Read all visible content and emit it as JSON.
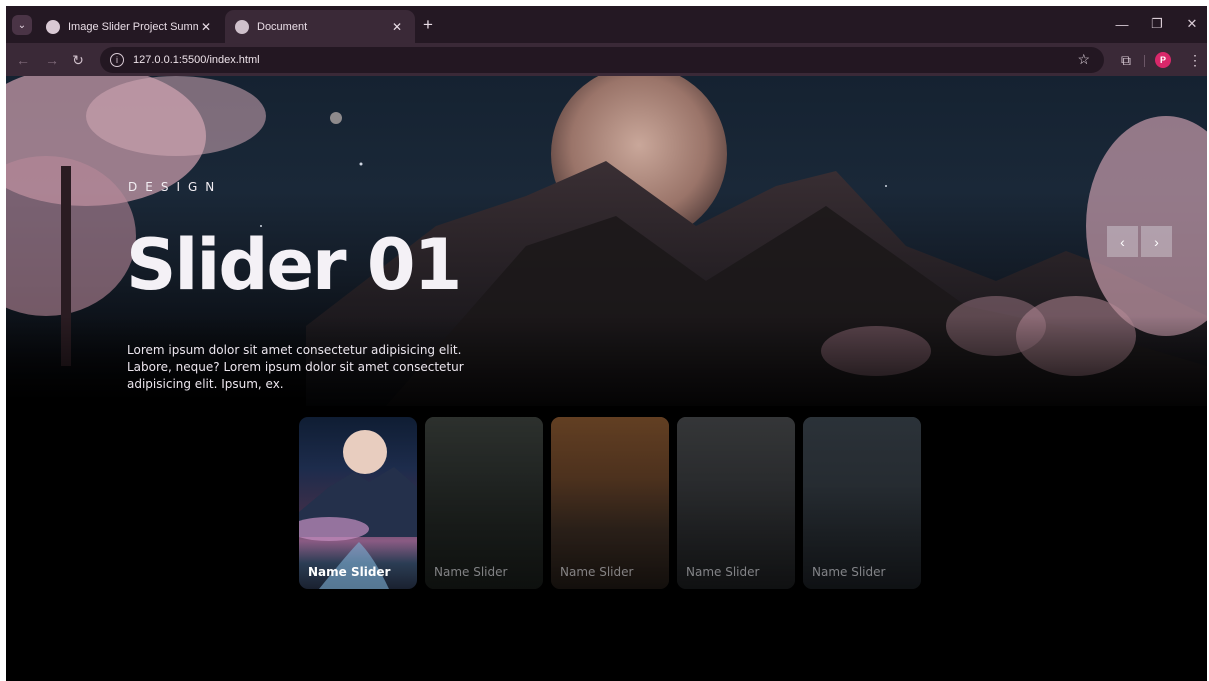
{
  "browser": {
    "tabs": [
      {
        "title": "Image Slider Project Summary",
        "active": false
      },
      {
        "title": "Document",
        "active": true
      }
    ],
    "new_tab_label": "+",
    "url": "127.0.0.1:5500/index.html",
    "profile_initial": "P",
    "window_controls": [
      "minimize",
      "restore",
      "close"
    ]
  },
  "slider": {
    "kicker": "DESIGN",
    "title": "Slider 01",
    "description": "Lorem ipsum dolor sit amet consectetur adipisicing elit. Labore, neque? Lorem ipsum dolor sit amet consectetur adipisicing elit. Ipsum, ex.",
    "prev_label": "‹",
    "next_label": "›",
    "thumbnails": [
      {
        "label": "Name Slider",
        "active": true
      },
      {
        "label": "Name Slider",
        "active": false
      },
      {
        "label": "Name Slider",
        "active": false
      },
      {
        "label": "Name Slider",
        "active": false
      },
      {
        "label": "Name Slider",
        "active": false
      }
    ]
  },
  "colors": {
    "tabstrip": "#241823",
    "toolbar": "#3a2937",
    "page_bg": "#000000",
    "profile": "#d8286a"
  }
}
